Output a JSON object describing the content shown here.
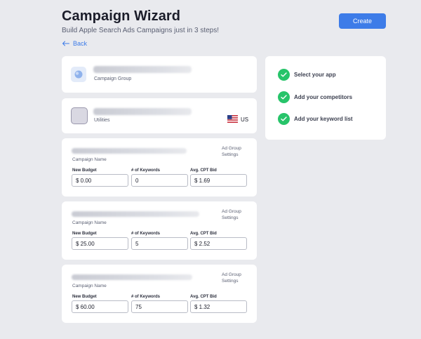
{
  "header": {
    "title": "Campaign Wizard",
    "subtitle": "Build Apple Search Ads Campaigns just in 3 steps!",
    "create_label": "Create",
    "back_label": "Back"
  },
  "campaign_group_card": {
    "label": "Campaign Group"
  },
  "app_card": {
    "category": "Utilities",
    "country": "US"
  },
  "campaigns": [
    {
      "name_label": "Campaign Name",
      "settings_label": "Ad Group Settings",
      "budget_label": "New Budget",
      "keywords_label": "# of Keywords",
      "cpt_label": "Avg. CPT Bid",
      "budget": "$ 0.00",
      "keywords": "0",
      "cpt": "$ 1.69"
    },
    {
      "name_label": "Campaign Name",
      "settings_label": "Ad Group Settings",
      "budget_label": "New Budget",
      "keywords_label": "# of Keywords",
      "cpt_label": "Avg. CPT Bid",
      "budget": "$ 25.00",
      "keywords": "5",
      "cpt": "$ 2.52"
    },
    {
      "name_label": "Campaign Name",
      "settings_label": "Ad Group Settings",
      "budget_label": "New Budget",
      "keywords_label": "# of Keywords",
      "cpt_label": "Avg. CPT Bid",
      "budget": "$ 60.00",
      "keywords": "75",
      "cpt": "$ 1.32"
    }
  ],
  "steps": [
    {
      "label": "Select your app",
      "icon": "check-icon"
    },
    {
      "label": "Add your competitors",
      "icon": "check-icon"
    },
    {
      "label": "Add your keyword list",
      "icon": "check-icon"
    }
  ],
  "colors": {
    "accent": "#3d7ce8",
    "success": "#27c46a",
    "background": "#e9eaee"
  }
}
